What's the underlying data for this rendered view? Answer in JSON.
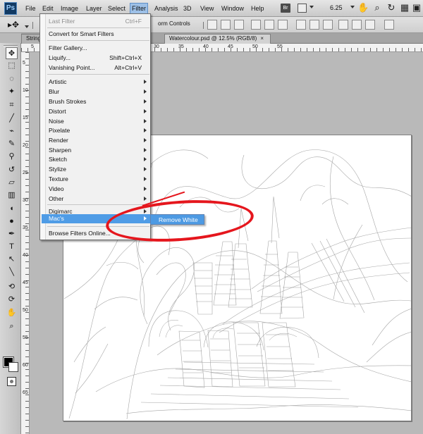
{
  "menu_bar": {
    "items": [
      "File",
      "Edit",
      "Image",
      "Layer",
      "Select",
      "Filter",
      "Analysis",
      "3D",
      "View",
      "Window",
      "Help"
    ],
    "logo": "Ps",
    "bridge": "Br",
    "zoom": "6.25"
  },
  "options_bar": {
    "transform_controls": "orm Controls"
  },
  "tabs": {
    "first": "String",
    "second": "Watercolour.psd @ 12.5% (RGB/8)",
    "close": "×"
  },
  "filter_menu": {
    "last_filter": "Last Filter",
    "last_filter_shortcut": "Ctrl+F",
    "convert": "Convert for Smart Filters",
    "filter_gallery": "Filter Gallery...",
    "liquify": "Liquify...",
    "liquify_shortcut": "Shift+Ctrl+X",
    "vanishing_point": "Vanishing Point...",
    "vanishing_point_shortcut": "Alt+Ctrl+V",
    "categories": [
      "Artistic",
      "Blur",
      "Brush Strokes",
      "Distort",
      "Noise",
      "Pixelate",
      "Render",
      "Sharpen",
      "Sketch",
      "Stylize",
      "Texture",
      "Video",
      "Other"
    ],
    "digimarc": "Digimarc",
    "macs": "Mac's",
    "browse_filters": "Browse Filters Online..."
  },
  "submenu": {
    "remove_white": "Remove White"
  },
  "rulers": {
    "top": [
      "5",
      "10",
      "15",
      "20",
      "25",
      "30",
      "35",
      "40",
      "45",
      "50",
      "55"
    ],
    "left": [
      "5",
      "10",
      "15",
      "20",
      "25",
      "30",
      "35",
      "40",
      "45",
      "50",
      "55",
      "60",
      "65"
    ]
  },
  "icons": {
    "options_tool": "move-tool-icon",
    "tools": [
      "move-tool-icon",
      "marquee-tool-icon",
      "lasso-tool-icon",
      "quick-selection-icon",
      "crop-tool-icon",
      "eyedropper-icon",
      "healing-brush-icon",
      "brush-tool-icon",
      "clone-stamp-icon",
      "history-brush-icon",
      "eraser-icon",
      "gradient-icon",
      "blur-tool-icon",
      "dodge-tool-icon",
      "pen-tool-icon",
      "type-tool-icon",
      "path-selection-icon",
      "shape-tool-icon",
      "3d-rotate-icon",
      "3d-orbit-icon",
      "hand-tool-icon",
      "zoom-tool-icon"
    ]
  },
  "colors": {
    "menu_highlight": "#4f9ce6",
    "annotation_red": "#e5161d",
    "canvas_background": "#b9b9b9"
  }
}
